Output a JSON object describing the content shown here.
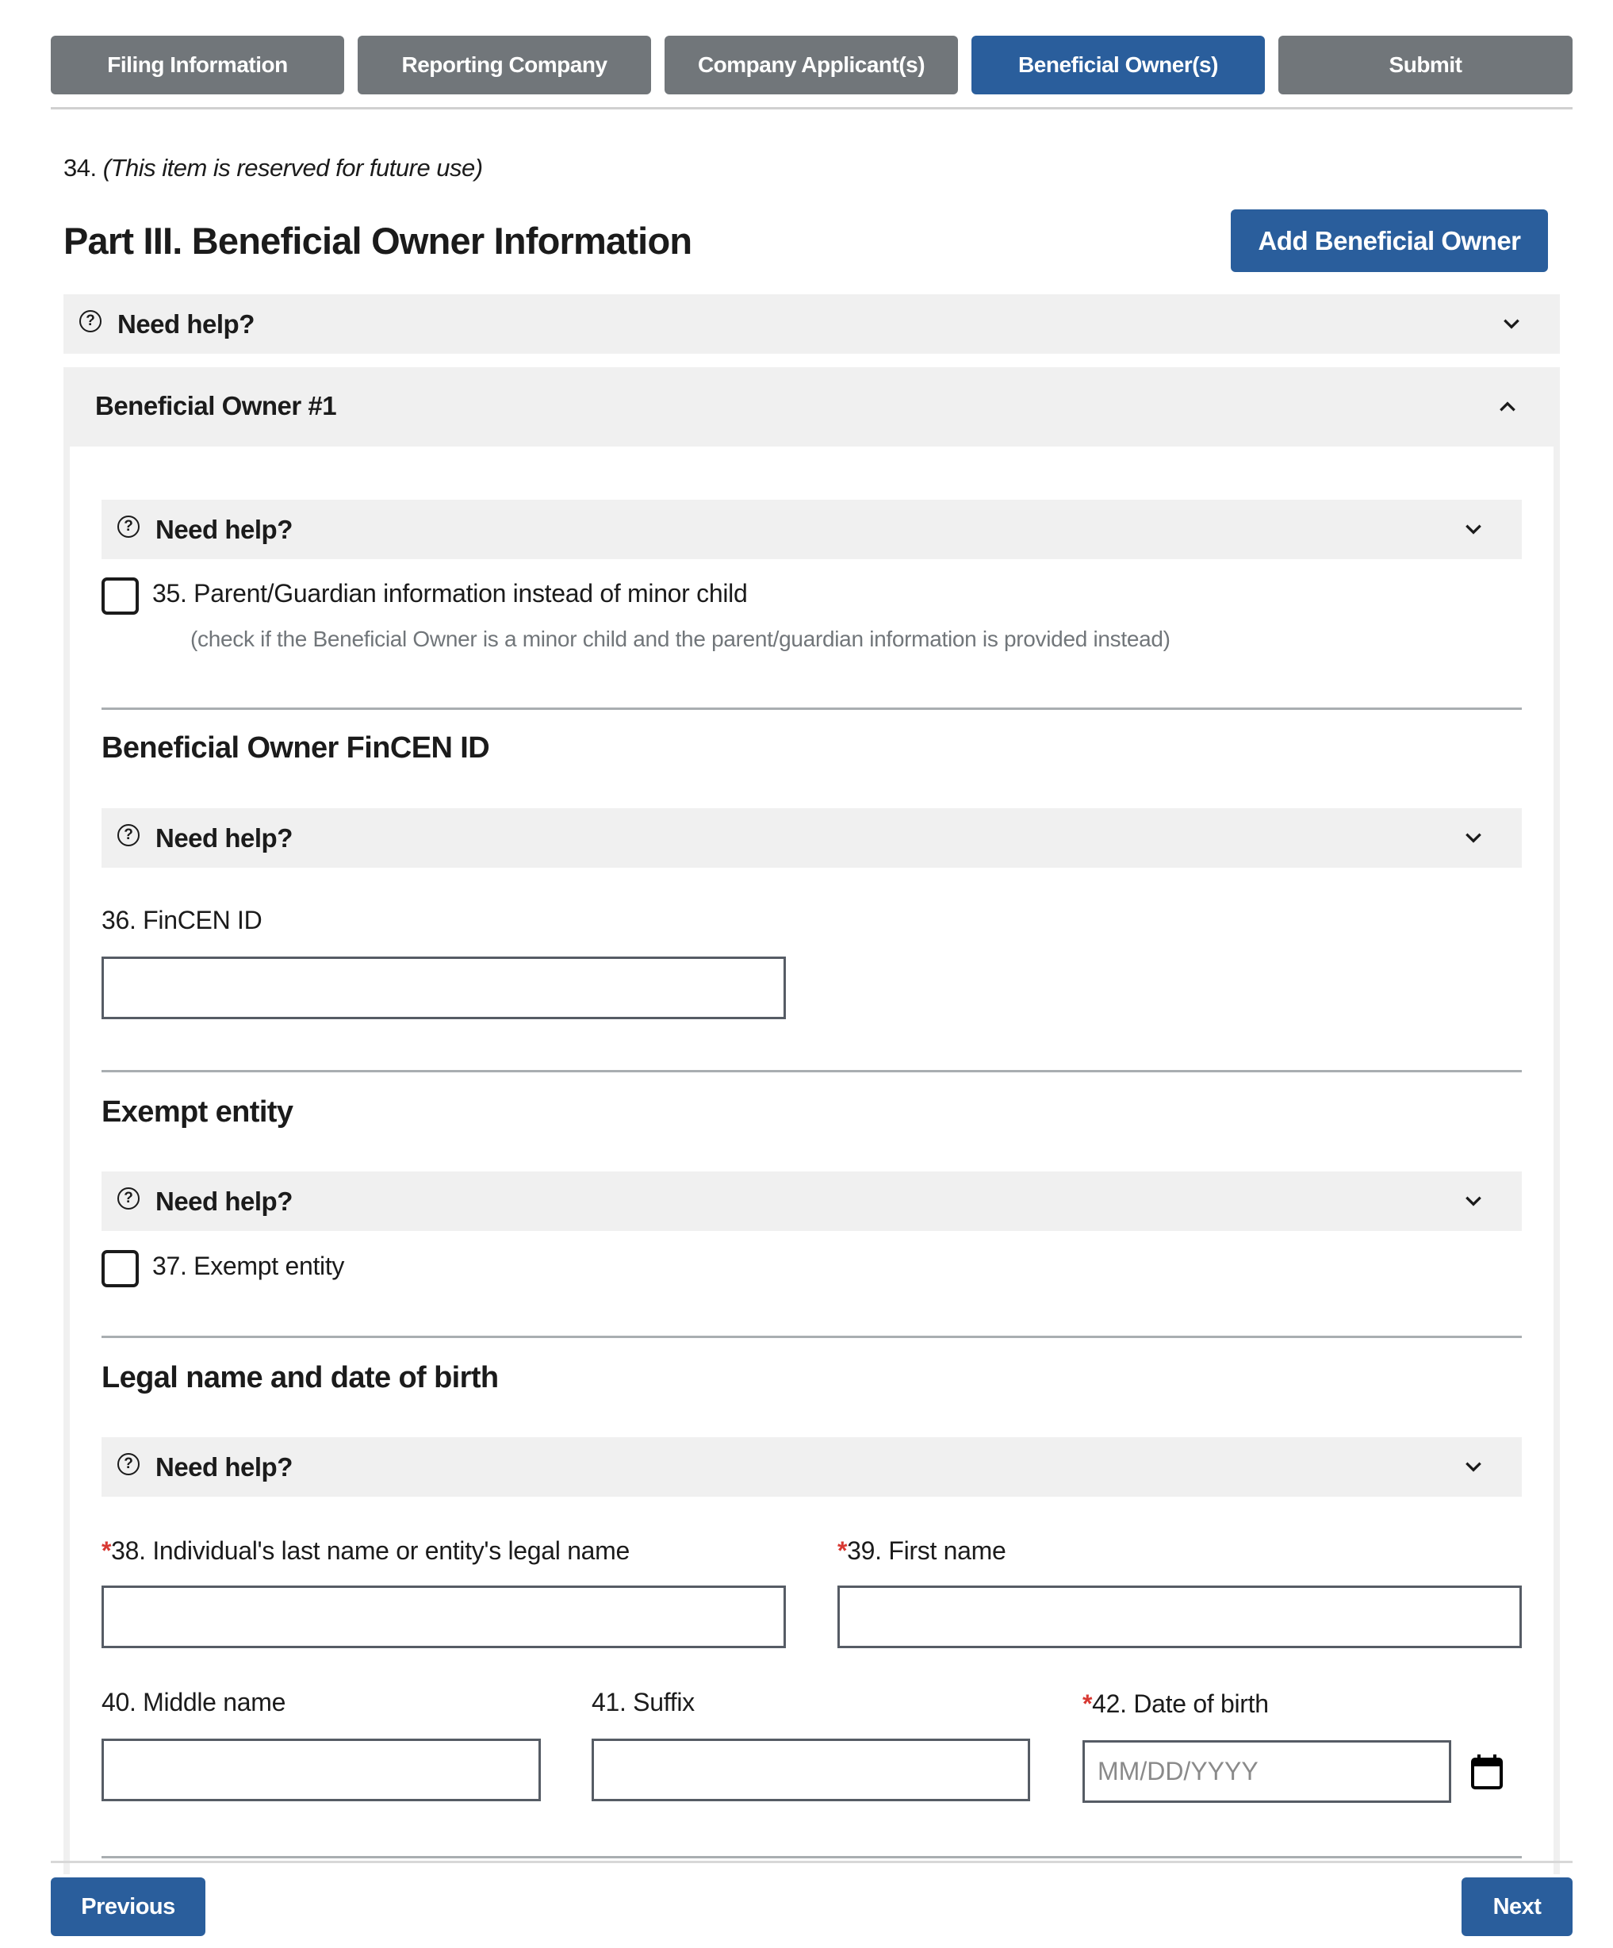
{
  "colors": {
    "primary": "#2a5e9c",
    "tab_inactive": "#71767a",
    "required": "#d83933",
    "panel_bg": "#f0f0f0"
  },
  "steps": [
    {
      "label": "Filing Information",
      "active": false
    },
    {
      "label": "Reporting Company",
      "active": false
    },
    {
      "label": "Company Applicant(s)",
      "active": false
    },
    {
      "label": "Beneficial Owner(s)",
      "active": true
    },
    {
      "label": "Submit",
      "active": false
    }
  ],
  "reserved_item": {
    "number": "34.",
    "text": "(This item is reserved for future use)"
  },
  "page_title": "Part III. Beneficial Owner Information",
  "add_button": "Add Beneficial Owner",
  "help_label": "Need help?",
  "icons": {
    "help": "question-circle-icon",
    "expand": "chevron-down-icon",
    "collapse": "chevron-up-icon",
    "calendar": "calendar-icon"
  },
  "owner": {
    "title": "Beneficial Owner #1",
    "parent_guardian": {
      "label": "35. Parent/Guardian information instead of minor child",
      "hint": "(check if the Beneficial Owner is a minor child and the parent/guardian information is provided instead)",
      "checked": false
    },
    "fincen_section": {
      "title": "Beneficial Owner FinCEN ID",
      "field_label": "36. FinCEN ID",
      "value": ""
    },
    "exempt_section": {
      "title": "Exempt entity",
      "checkbox_label": "37. Exempt entity",
      "checked": false
    },
    "legal_section": {
      "title": "Legal name and date of birth",
      "required_mark": "*",
      "last_name": {
        "label": "38. Individual's last name or entity's legal name",
        "required": true,
        "value": ""
      },
      "first_name": {
        "label": "39. First name",
        "required": true,
        "value": ""
      },
      "middle_name": {
        "label": "40. Middle name",
        "required": false,
        "value": ""
      },
      "suffix": {
        "label": "41. Suffix",
        "required": false,
        "value": ""
      },
      "dob": {
        "label": "42. Date of birth",
        "required": true,
        "value": "",
        "placeholder": "MM/DD/YYYY"
      }
    }
  },
  "footer": {
    "previous": "Previous",
    "next": "Next"
  }
}
